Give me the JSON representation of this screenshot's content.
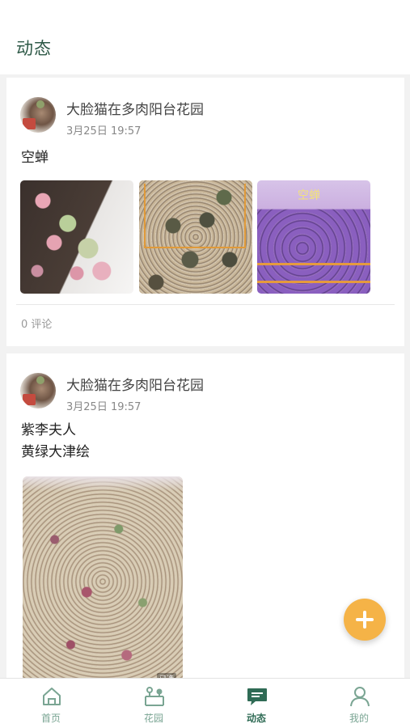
{
  "header": {
    "title": "动态"
  },
  "posts": [
    {
      "user": "大脸猫在多肉阳台花园",
      "time": "3月25日 19:57",
      "text": "空蝉",
      "image_label": "空蝉",
      "comments": "0 评论"
    },
    {
      "user": "大脸猫在多肉阳台花园",
      "time": "3月25日 19:57",
      "text_line1": "紫李夫人",
      "text_line2": "黄绿大津绘",
      "image_tag": "已选"
    }
  ],
  "tabs": [
    {
      "label": "首页",
      "icon": "home-icon"
    },
    {
      "label": "花园",
      "icon": "garden-icon"
    },
    {
      "label": "动态",
      "icon": "feed-icon",
      "active": true
    },
    {
      "label": "我的",
      "icon": "profile-icon"
    }
  ],
  "colors": {
    "accent": "#2f6b55",
    "fab": "#f5b347",
    "tab_inactive": "#7aa593"
  }
}
